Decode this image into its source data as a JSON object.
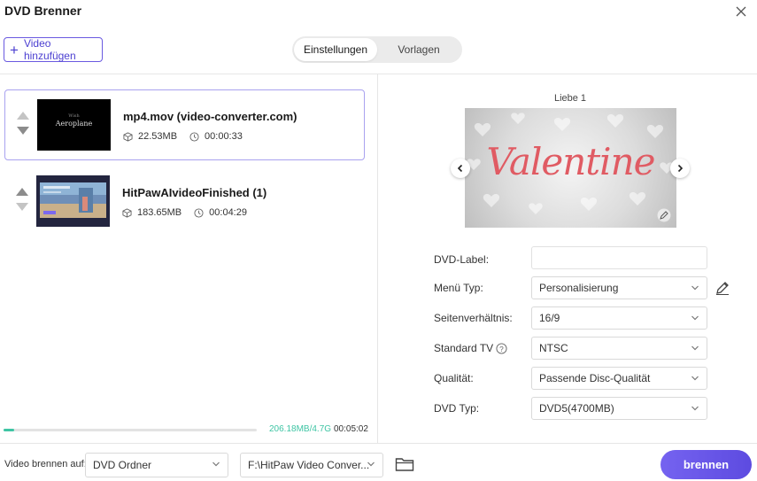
{
  "window": {
    "title": "DVD Brenner"
  },
  "toolbar": {
    "add_video_label": "Video hinzufügen",
    "tabs": [
      {
        "label": "Einstellungen",
        "active": true
      },
      {
        "label": "Vorlagen",
        "active": false
      }
    ]
  },
  "videos": [
    {
      "name": "mp4.mov (video-converter.com)",
      "size": "22.53MB",
      "duration": "00:00:33",
      "selected": true,
      "thumb_small_text": "Wish",
      "thumb_big_text": "Aeroplane"
    },
    {
      "name": "HitPawAIvideoFinished (1)",
      "size": "183.65MB",
      "duration": "00:04:29",
      "selected": false
    }
  ],
  "storage": {
    "used_label": "206.18MB/4.7G",
    "total_duration": "00:05:02",
    "used_fraction": 0.043
  },
  "template": {
    "name": "Liebe 1",
    "preview_text": "Valentine"
  },
  "form": {
    "dvd_label": {
      "label": "DVD-Label:",
      "value": ""
    },
    "menu_type": {
      "label": "Menü Typ:",
      "value": "Personalisierung"
    },
    "aspect_ratio": {
      "label": "Seitenverhältnis:",
      "value": "16/9"
    },
    "standard_tv": {
      "label": "Standard TV",
      "value": "NTSC"
    },
    "quality": {
      "label": "Qualität:",
      "value": "Passende Disc-Qualität"
    },
    "dvd_type": {
      "label": "DVD Typ:",
      "value": "DVD5(4700MB)"
    }
  },
  "footer": {
    "burn_to_label": "Video brennen auf:",
    "target_value": "DVD Ordner",
    "path_value": "F:\\HitPaw Video Conver...",
    "burn_button": "brennen"
  },
  "colors": {
    "accent": "#5d4be0",
    "progress": "#3fc5a4",
    "valentine_text": "#e05b63"
  }
}
